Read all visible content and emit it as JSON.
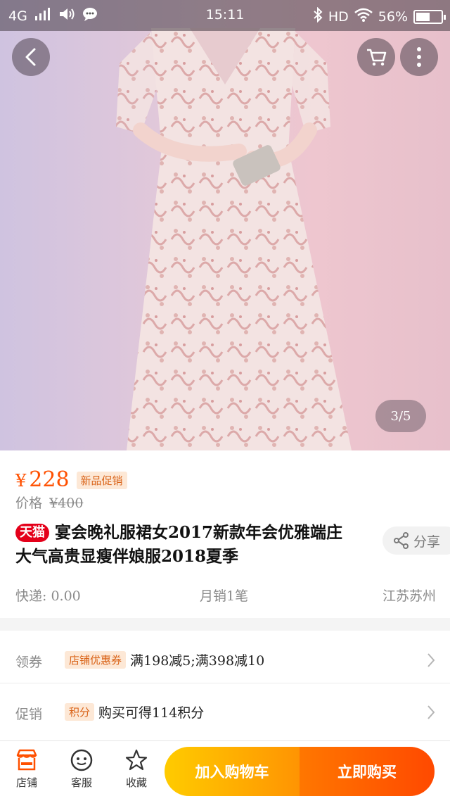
{
  "status_bar": {
    "network": "4G",
    "time": "15:11",
    "hd": "HD",
    "battery_percent": "56%",
    "battery_level": 0.56
  },
  "product_image": {
    "page_indicator": "3/5"
  },
  "price": {
    "currency": "¥",
    "current": "228",
    "promo_badge": "新品促销",
    "orig_label": "价格",
    "orig_price": "¥400"
  },
  "title": {
    "tmall_badge": "天猫",
    "line1": "宴会晚礼服裙女2017新款年会优雅端庄",
    "line2": "大气高贵显瘦伴娘服2018夏季",
    "share_label": "分享"
  },
  "meta": {
    "shipping": "快递: 0.00",
    "monthly_sales": "月销1笔",
    "location": "江苏苏州"
  },
  "coupon_row": {
    "label": "领券",
    "tag": "店铺优惠券",
    "text": "满198减5;满398减10"
  },
  "promo_row": {
    "label": "促销",
    "tag": "积分",
    "text": "购买可得114积分"
  },
  "bottom_bar": {
    "shop": "店铺",
    "service": "客服",
    "favorite": "收藏",
    "add_to_cart": "加入购物车",
    "buy_now": "立即购买"
  },
  "colors": {
    "accent": "#ff5000",
    "tmall_red": "#e4001a",
    "cart_gradient": [
      "#ffcb00",
      "#ff9402"
    ],
    "buy_gradient": [
      "#ff7700",
      "#ff4900"
    ]
  },
  "icons": [
    "signal-icon",
    "volume-icon",
    "message-icon",
    "bluetooth-icon",
    "wifi-icon",
    "battery-icon",
    "back-icon",
    "cart-icon",
    "more-icon",
    "share-icon",
    "chevron-right-icon",
    "shop-icon",
    "service-icon",
    "star-icon"
  ]
}
